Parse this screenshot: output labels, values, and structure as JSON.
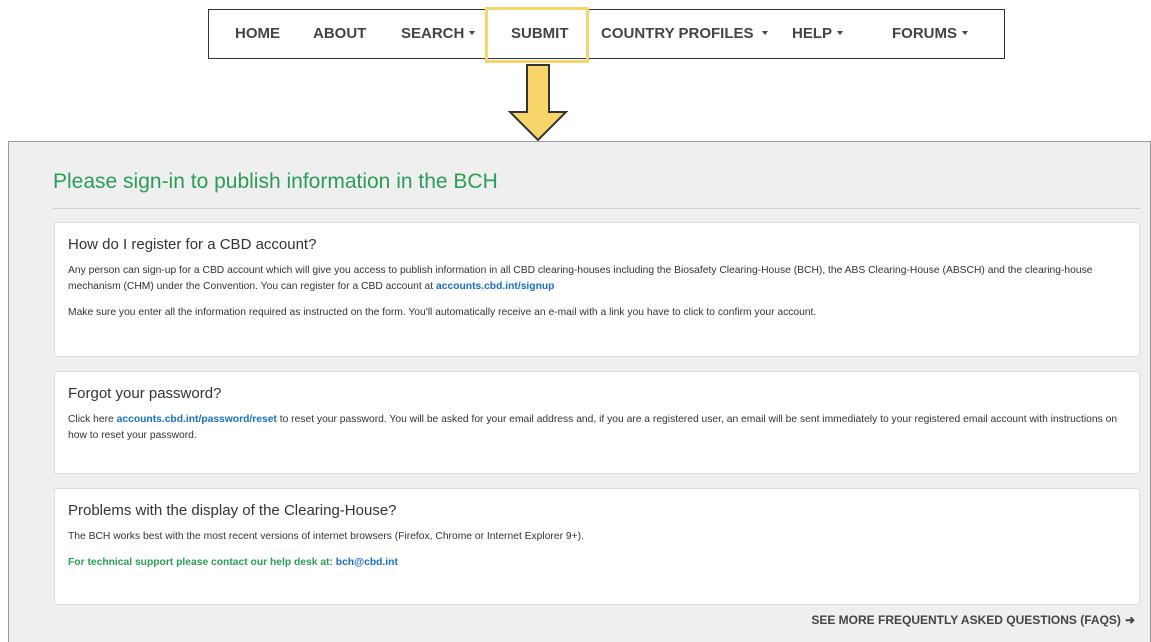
{
  "nav": {
    "home": "HOME",
    "about": "ABOUT",
    "search": "SEARCH",
    "submit": "SUBMIT",
    "country_profiles": "COUNTRY PROFILES",
    "help": "HELP",
    "forums": "FORUMS"
  },
  "page": {
    "title": "Please sign-in to publish information in the BCH"
  },
  "register": {
    "heading": "How do I register for a CBD account?",
    "p1": "Any person can sign-up for a CBD account which will give you access to publish information in all CBD clearing-houses including the Biosafety Clearing-House (BCH), the ABS Clearing-House (ABSCH) and the clearing-house mechanism (CHM) under the Convention. You can register for a CBD account at ",
    "p1_link": "accounts.cbd.int/signup",
    "p2": "Make sure you enter all the information required as instructed on the form. You'll automatically receive an e-mail with a link you have to click to confirm your account."
  },
  "password": {
    "heading": "Forgot your password?",
    "p1_pre": "Click here ",
    "p1_link": "accounts.cbd.int/password/reset",
    "p1_post": " to reset your password. You will be asked for your email address and, if you are a registered user, an email will be sent immediately to your registered email account with instructions on how to reset your password."
  },
  "display": {
    "heading": "Problems with the display of the Clearing-House?",
    "p1": "The BCH works best with the most recent versions of internet browsers (Firefox, Chrome or Internet Explorer 9+).",
    "support_text": "For technical support please contact our help desk at: ",
    "support_email": "bch@cbd.int"
  },
  "faq": {
    "label": "SEE MORE FREQUENTLY ASKED QUESTIONS (FAQS)"
  },
  "colors": {
    "accent_green": "#2a9d59",
    "link_blue": "#1a6fc4",
    "highlight_yellow": "#f7d56a"
  }
}
